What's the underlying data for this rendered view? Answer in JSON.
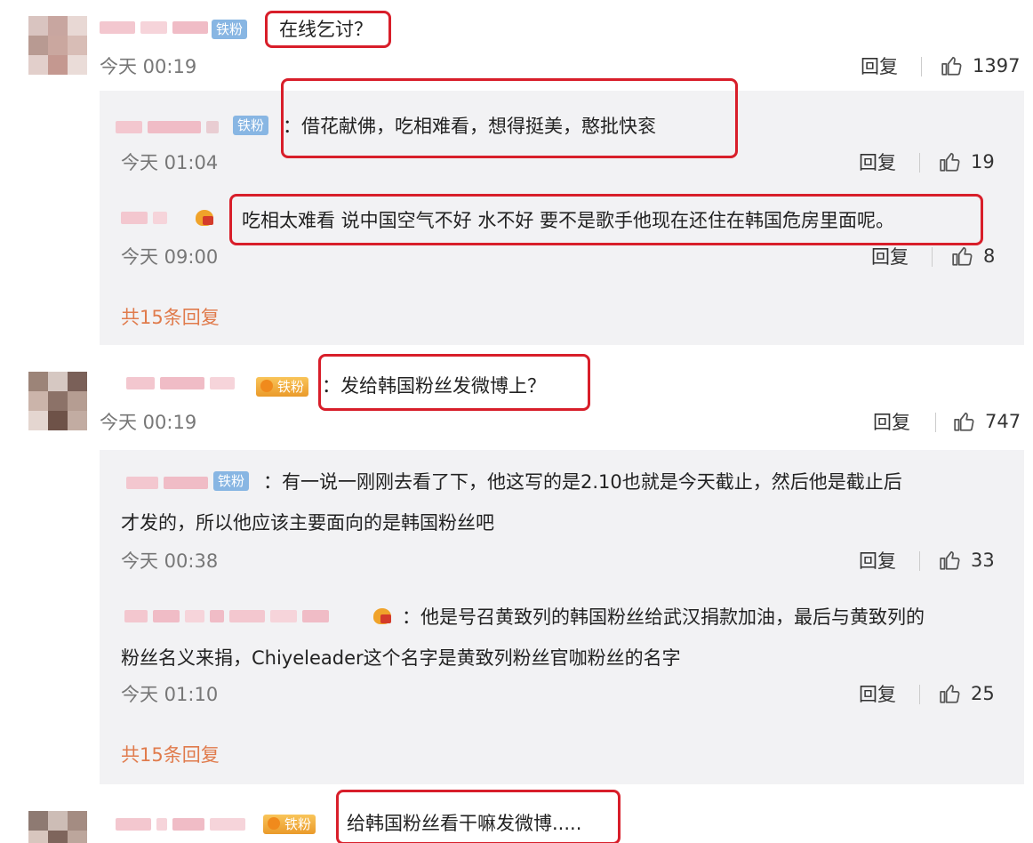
{
  "comments": [
    {
      "text": "在线乞讨？",
      "badge": "铁粉",
      "time": "今天 00:19",
      "reply_label": "回复",
      "likes": "1397",
      "replies": [
        {
          "text": "：借花献佛，吃相难看，想得挺美，憨批快衮",
          "badge": "铁粉",
          "time": "今天 01:04",
          "reply_label": "回复",
          "likes": "19"
        },
        {
          "text": "吃相太难看 说中国空气不好 水不好 要不是歌手他现在还住在韩国危房里面呢。",
          "time": "今天 09:00",
          "reply_label": "回复",
          "likes": "8"
        }
      ],
      "more_replies": "共15条回复"
    },
    {
      "text": "：发给韩国粉丝发微博上？",
      "badge": "铁粉",
      "time": "今天 00:19",
      "reply_label": "回复",
      "likes": "747",
      "replies": [
        {
          "line1": "：有一说一刚刚去看了下，他这写的是2.10也就是今天截止，然后他是截止后",
          "line2": "才发的，所以他应该主要面向的是韩国粉丝吧",
          "badge": "铁粉",
          "time": "今天 00:38",
          "reply_label": "回复",
          "likes": "33"
        },
        {
          "line1": "：他是号召黄致列的韩国粉丝给武汉捐款加油，最后与黄致列的",
          "line2": "粉丝名义来捐，Chiyeleader这个名字是黄致列粉丝官咖粉丝的名字",
          "time": "今天 01:10",
          "reply_label": "回复",
          "likes": "25"
        }
      ],
      "more_replies": "共15条回复"
    },
    {
      "text": "给韩国粉丝看干嘛发微博.....",
      "badge": "铁粉"
    }
  ],
  "colors": {
    "highlight_border": "#d81e2a",
    "more_link": "#e07b4c",
    "badge_blue": "#88b6e3",
    "panel_bg": "#f2f2f4"
  },
  "icons": {
    "like": "thumbs-up-icon",
    "vip": "vip-crown-icon"
  }
}
